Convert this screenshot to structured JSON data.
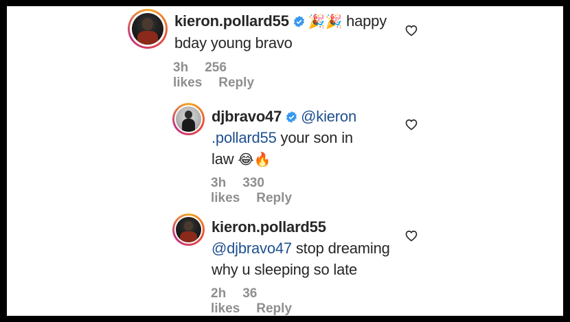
{
  "comments": [
    {
      "username": "kieron.pollard55",
      "verified": true,
      "emoji_prefix": "🎉🎉",
      "text_line1": "happy",
      "text_line2": "bday young bravo",
      "time": "3h",
      "likes": "256 likes",
      "reply": "Reply"
    },
    {
      "username": "djbravo47",
      "verified": true,
      "mention_a": "@kieron",
      "mention_b": ".pollard55",
      "text_a": " your son in",
      "text_b": "law ",
      "emoji": "😂🔥",
      "time": "3h",
      "likes": "330 likes",
      "reply": "Reply"
    },
    {
      "username": "kieron.pollard55",
      "verified": false,
      "mention": "@djbravo47",
      "text_a": " stop dreaming",
      "text_b": "why u sleeping so late",
      "time": "2h",
      "likes": "36 likes",
      "reply": "Reply"
    }
  ],
  "icons": {
    "verified": "verified-badge-icon",
    "like": "heart-outline-icon"
  },
  "colors": {
    "mention": "#1e4f8f",
    "verified": "#3897f0",
    "meta": "#8e8e8e"
  }
}
